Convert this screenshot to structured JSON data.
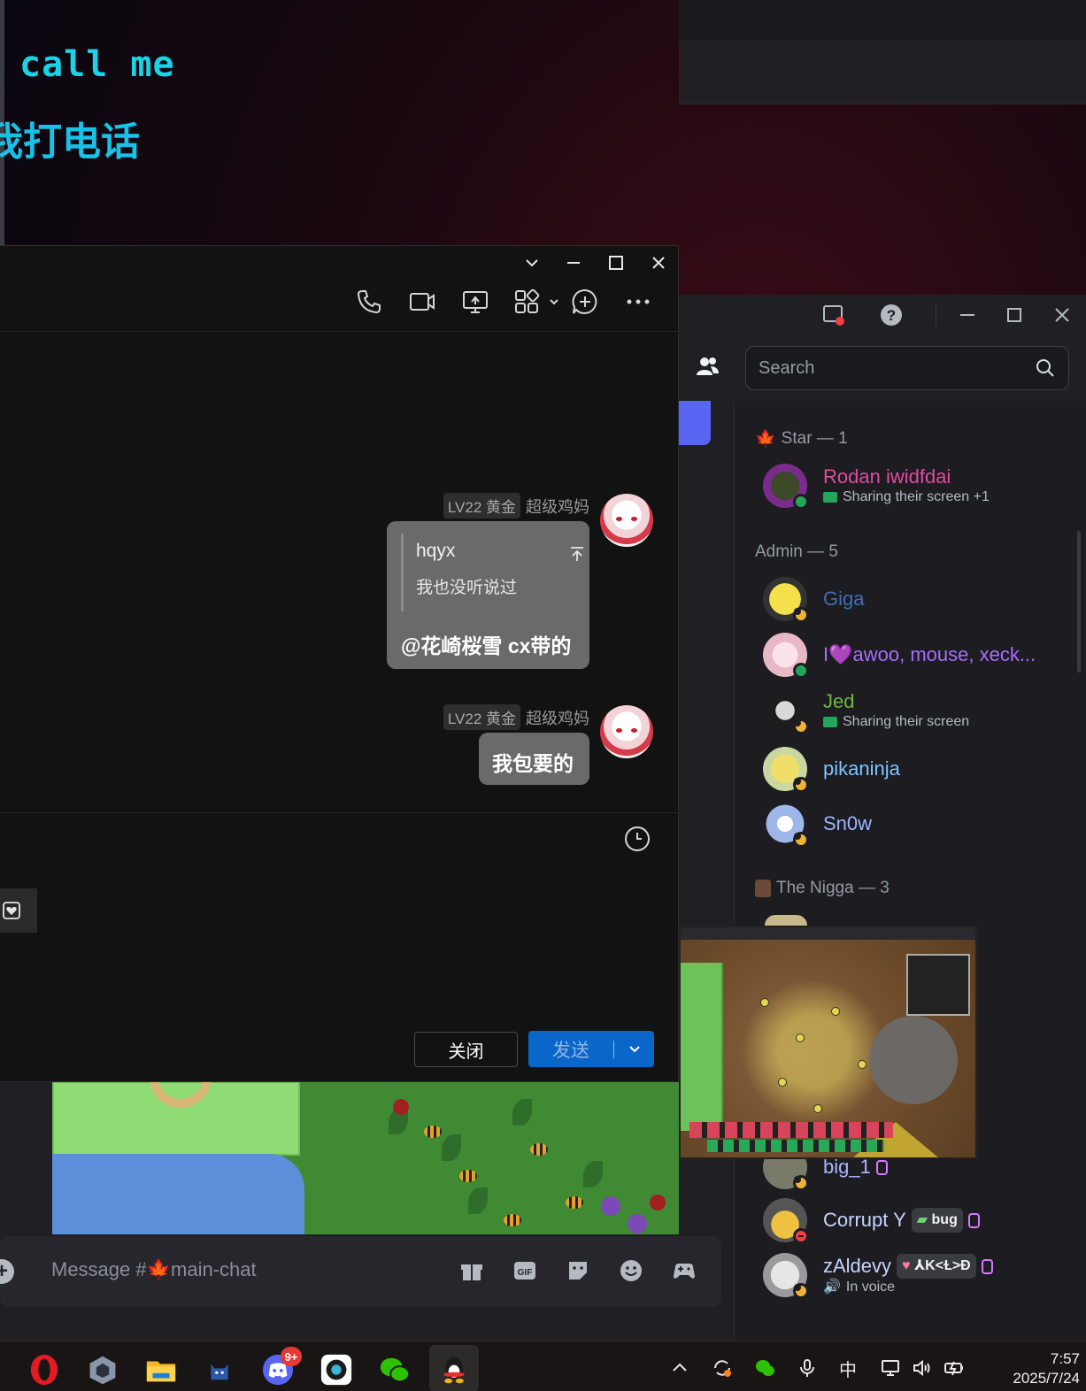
{
  "wallpaper": {
    "line1": "call me",
    "line2": "我打电话"
  },
  "discord": {
    "search_placeholder": "Search",
    "composer_placeholder": "Message #🍁main-chat",
    "groups": [
      {
        "label": "Star — 1"
      },
      {
        "label": "Admin — 5"
      },
      {
        "label": "The Nigga — 3"
      }
    ],
    "members": {
      "rodan": {
        "name": "Rodan iwidfdai",
        "sub": "Sharing their screen +1",
        "color": "#e04ca0"
      },
      "giga": {
        "name": "Giga",
        "color": "#3f6fb8"
      },
      "iwawoo": {
        "name": "I💜awoo, mouse, xeck...",
        "color": "#a66dff"
      },
      "jed": {
        "name": "Jed",
        "sub": "Sharing their screen",
        "color": "#6fb83a"
      },
      "pikaninja": {
        "name": "pikaninja",
        "color": "#7fc4ff"
      },
      "snow": {
        "name": "Sn0w",
        "color": "#9ab6ff"
      },
      "big": {
        "name": "big_1",
        "color": "#a8b8ff"
      },
      "corrupt": {
        "name": "Corrupt Y",
        "tag": "bug",
        "color": "#c8d4ff"
      },
      "zaldevy": {
        "name": "zAldevy",
        "tag": "⅄K<Ɫ>Ð",
        "sub": "In voice",
        "color": "#c8d4ff"
      }
    }
  },
  "qq": {
    "messages": [
      {
        "level": "LV22 黄金",
        "sender": "超级鸡妈",
        "quote_name": "hqyx",
        "quote_text": "我也没听说过",
        "text": "@花崎桜雪 cx带的"
      },
      {
        "level": "LV22 黄金",
        "sender": "超级鸡妈",
        "text": "我包要的"
      }
    ],
    "close_label": "关闭",
    "send_label": "发送"
  },
  "taskbar": {
    "discord_badge": "9+",
    "ime": "中",
    "time": "7:57",
    "date": "2025/7/24"
  }
}
